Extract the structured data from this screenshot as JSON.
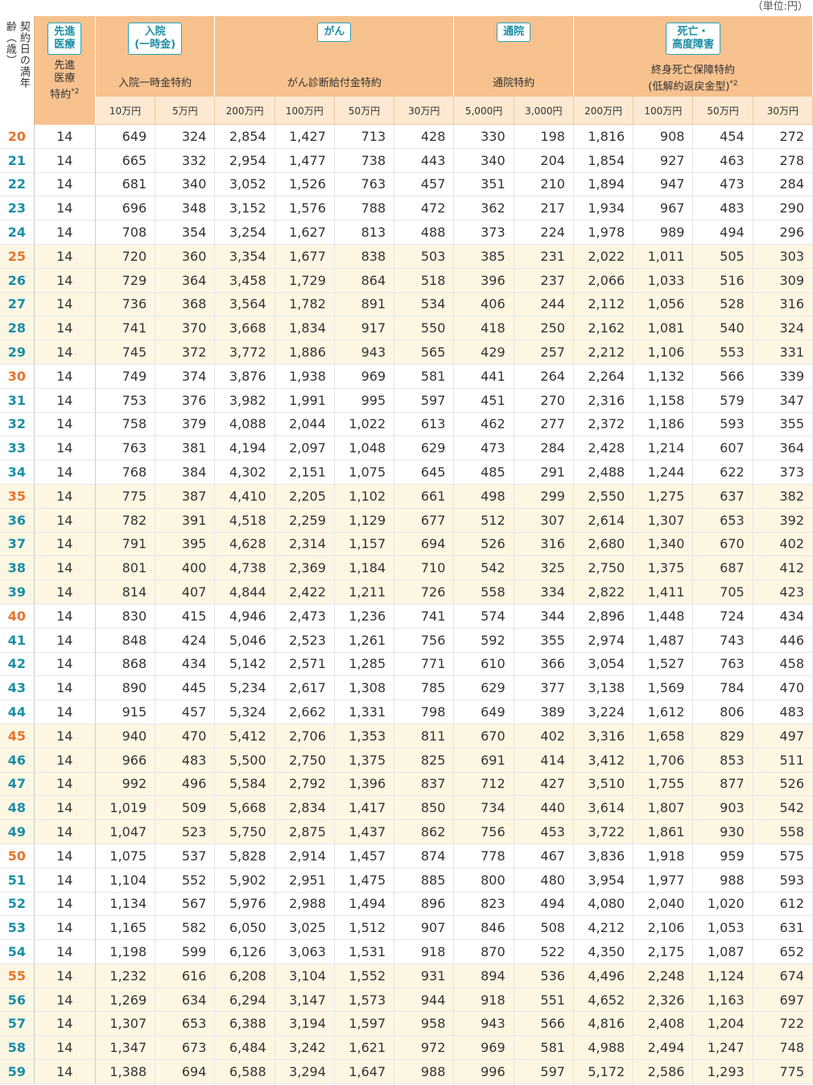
{
  "unit_label": "（単位:円）",
  "header": {
    "age_label": "契約日の満年齢（歳）",
    "groups": [
      {
        "badge": "先進\n医療",
        "title": "先進\n医療\n特約",
        "sup": "*2",
        "cols": 1
      },
      {
        "badge": "入院\n(一時金)",
        "title": "入院一時金特約",
        "sup": "",
        "cols": 2
      },
      {
        "badge": "がん",
        "title": "がん診断給付金特約",
        "sup": "",
        "cols": 4
      },
      {
        "badge": "通院",
        "title": "通院特約",
        "sup": "",
        "cols": 2
      },
      {
        "badge": "死亡・\n高度障害",
        "title": "終身死亡保障特約\n(低解約返戻金型)",
        "sup": "*2",
        "cols": 4
      }
    ],
    "subheaders": [
      "10万円",
      "5万円",
      "200万円",
      "100万円",
      "50万円",
      "30万円",
      "5,000円",
      "3,000円",
      "200万円",
      "100万円",
      "50万円",
      "30万円"
    ]
  },
  "rows": [
    [
      "20",
      "14",
      "649",
      "324",
      "2,854",
      "1,427",
      "713",
      "428",
      "330",
      "198",
      "1,816",
      "908",
      "454",
      "272"
    ],
    [
      "21",
      "14",
      "665",
      "332",
      "2,954",
      "1,477",
      "738",
      "443",
      "340",
      "204",
      "1,854",
      "927",
      "463",
      "278"
    ],
    [
      "22",
      "14",
      "681",
      "340",
      "3,052",
      "1,526",
      "763",
      "457",
      "351",
      "210",
      "1,894",
      "947",
      "473",
      "284"
    ],
    [
      "23",
      "14",
      "696",
      "348",
      "3,152",
      "1,576",
      "788",
      "472",
      "362",
      "217",
      "1,934",
      "967",
      "483",
      "290"
    ],
    [
      "24",
      "14",
      "708",
      "354",
      "3,254",
      "1,627",
      "813",
      "488",
      "373",
      "224",
      "1,978",
      "989",
      "494",
      "296"
    ],
    [
      "25",
      "14",
      "720",
      "360",
      "3,354",
      "1,677",
      "838",
      "503",
      "385",
      "231",
      "2,022",
      "1,011",
      "505",
      "303"
    ],
    [
      "26",
      "14",
      "729",
      "364",
      "3,458",
      "1,729",
      "864",
      "518",
      "396",
      "237",
      "2,066",
      "1,033",
      "516",
      "309"
    ],
    [
      "27",
      "14",
      "736",
      "368",
      "3,564",
      "1,782",
      "891",
      "534",
      "406",
      "244",
      "2,112",
      "1,056",
      "528",
      "316"
    ],
    [
      "28",
      "14",
      "741",
      "370",
      "3,668",
      "1,834",
      "917",
      "550",
      "418",
      "250",
      "2,162",
      "1,081",
      "540",
      "324"
    ],
    [
      "29",
      "14",
      "745",
      "372",
      "3,772",
      "1,886",
      "943",
      "565",
      "429",
      "257",
      "2,212",
      "1,106",
      "553",
      "331"
    ],
    [
      "30",
      "14",
      "749",
      "374",
      "3,876",
      "1,938",
      "969",
      "581",
      "441",
      "264",
      "2,264",
      "1,132",
      "566",
      "339"
    ],
    [
      "31",
      "14",
      "753",
      "376",
      "3,982",
      "1,991",
      "995",
      "597",
      "451",
      "270",
      "2,316",
      "1,158",
      "579",
      "347"
    ],
    [
      "32",
      "14",
      "758",
      "379",
      "4,088",
      "2,044",
      "1,022",
      "613",
      "462",
      "277",
      "2,372",
      "1,186",
      "593",
      "355"
    ],
    [
      "33",
      "14",
      "763",
      "381",
      "4,194",
      "2,097",
      "1,048",
      "629",
      "473",
      "284",
      "2,428",
      "1,214",
      "607",
      "364"
    ],
    [
      "34",
      "14",
      "768",
      "384",
      "4,302",
      "2,151",
      "1,075",
      "645",
      "485",
      "291",
      "2,488",
      "1,244",
      "622",
      "373"
    ],
    [
      "35",
      "14",
      "775",
      "387",
      "4,410",
      "2,205",
      "1,102",
      "661",
      "498",
      "299",
      "2,550",
      "1,275",
      "637",
      "382"
    ],
    [
      "36",
      "14",
      "782",
      "391",
      "4,518",
      "2,259",
      "1,129",
      "677",
      "512",
      "307",
      "2,614",
      "1,307",
      "653",
      "392"
    ],
    [
      "37",
      "14",
      "791",
      "395",
      "4,628",
      "2,314",
      "1,157",
      "694",
      "526",
      "316",
      "2,680",
      "1,340",
      "670",
      "402"
    ],
    [
      "38",
      "14",
      "801",
      "400",
      "4,738",
      "2,369",
      "1,184",
      "710",
      "542",
      "325",
      "2,750",
      "1,375",
      "687",
      "412"
    ],
    [
      "39",
      "14",
      "814",
      "407",
      "4,844",
      "2,422",
      "1,211",
      "726",
      "558",
      "334",
      "2,822",
      "1,411",
      "705",
      "423"
    ],
    [
      "40",
      "14",
      "830",
      "415",
      "4,946",
      "2,473",
      "1,236",
      "741",
      "574",
      "344",
      "2,896",
      "1,448",
      "724",
      "434"
    ],
    [
      "41",
      "14",
      "848",
      "424",
      "5,046",
      "2,523",
      "1,261",
      "756",
      "592",
      "355",
      "2,974",
      "1,487",
      "743",
      "446"
    ],
    [
      "42",
      "14",
      "868",
      "434",
      "5,142",
      "2,571",
      "1,285",
      "771",
      "610",
      "366",
      "3,054",
      "1,527",
      "763",
      "458"
    ],
    [
      "43",
      "14",
      "890",
      "445",
      "5,234",
      "2,617",
      "1,308",
      "785",
      "629",
      "377",
      "3,138",
      "1,569",
      "784",
      "470"
    ],
    [
      "44",
      "14",
      "915",
      "457",
      "5,324",
      "2,662",
      "1,331",
      "798",
      "649",
      "389",
      "3,224",
      "1,612",
      "806",
      "483"
    ],
    [
      "45",
      "14",
      "940",
      "470",
      "5,412",
      "2,706",
      "1,353",
      "811",
      "670",
      "402",
      "3,316",
      "1,658",
      "829",
      "497"
    ],
    [
      "46",
      "14",
      "966",
      "483",
      "5,500",
      "2,750",
      "1,375",
      "825",
      "691",
      "414",
      "3,412",
      "1,706",
      "853",
      "511"
    ],
    [
      "47",
      "14",
      "992",
      "496",
      "5,584",
      "2,792",
      "1,396",
      "837",
      "712",
      "427",
      "3,510",
      "1,755",
      "877",
      "526"
    ],
    [
      "48",
      "14",
      "1,019",
      "509",
      "5,668",
      "2,834",
      "1,417",
      "850",
      "734",
      "440",
      "3,614",
      "1,807",
      "903",
      "542"
    ],
    [
      "49",
      "14",
      "1,047",
      "523",
      "5,750",
      "2,875",
      "1,437",
      "862",
      "756",
      "453",
      "3,722",
      "1,861",
      "930",
      "558"
    ],
    [
      "50",
      "14",
      "1,075",
      "537",
      "5,828",
      "2,914",
      "1,457",
      "874",
      "778",
      "467",
      "3,836",
      "1,918",
      "959",
      "575"
    ],
    [
      "51",
      "14",
      "1,104",
      "552",
      "5,902",
      "2,951",
      "1,475",
      "885",
      "800",
      "480",
      "3,954",
      "1,977",
      "988",
      "593"
    ],
    [
      "52",
      "14",
      "1,134",
      "567",
      "5,976",
      "2,988",
      "1,494",
      "896",
      "823",
      "494",
      "4,080",
      "2,040",
      "1,020",
      "612"
    ],
    [
      "53",
      "14",
      "1,165",
      "582",
      "6,050",
      "3,025",
      "1,512",
      "907",
      "846",
      "508",
      "4,212",
      "2,106",
      "1,053",
      "631"
    ],
    [
      "54",
      "14",
      "1,198",
      "599",
      "6,126",
      "3,063",
      "1,531",
      "918",
      "870",
      "522",
      "4,350",
      "2,175",
      "1,087",
      "652"
    ],
    [
      "55",
      "14",
      "1,232",
      "616",
      "6,208",
      "3,104",
      "1,552",
      "931",
      "894",
      "536",
      "4,496",
      "2,248",
      "1,124",
      "674"
    ],
    [
      "56",
      "14",
      "1,269",
      "634",
      "6,294",
      "3,147",
      "1,573",
      "944",
      "918",
      "551",
      "4,652",
      "2,326",
      "1,163",
      "697"
    ],
    [
      "57",
      "14",
      "1,307",
      "653",
      "6,388",
      "3,194",
      "1,597",
      "958",
      "943",
      "566",
      "4,816",
      "2,408",
      "1,204",
      "722"
    ],
    [
      "58",
      "14",
      "1,347",
      "673",
      "6,484",
      "3,242",
      "1,621",
      "972",
      "969",
      "581",
      "4,988",
      "2,494",
      "1,247",
      "748"
    ],
    [
      "59",
      "14",
      "1,388",
      "694",
      "6,588",
      "3,294",
      "1,647",
      "988",
      "996",
      "597",
      "5,172",
      "2,586",
      "1,293",
      "775"
    ]
  ],
  "colors": {
    "header_bg": "#f7c28e",
    "subheader_bg": "#fde9d1",
    "highlight_row": "#fdf6e3",
    "age_teal": "#1b8ea5",
    "age_orange": "#e6752a"
  }
}
